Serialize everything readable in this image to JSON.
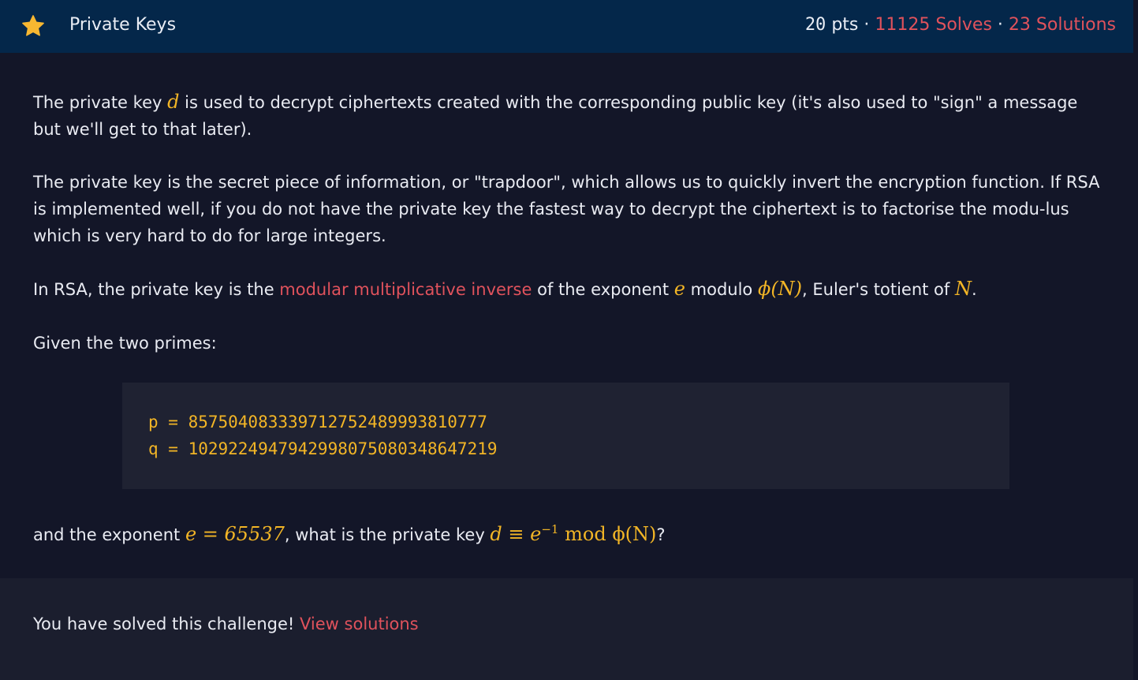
{
  "header": {
    "title": "Private Keys",
    "points": "20",
    "points_suffix": "pts",
    "separator": "·",
    "solves": "11125 Solves",
    "solutions": "23 Solutions"
  },
  "body": {
    "p1_a": "The private key ",
    "p1_d": "d",
    "p1_b": " is used to decrypt ciphertexts created with the corresponding public key (it's also used to \"sign\" a message but we'll get to that later).",
    "p2": "The private key is the secret piece of information, or \"trapdoor\", which allows us to quickly invert the encryption function. If RSA is implemented well, if you do not have the private key the fastest way to decrypt the ciphertext is to factorise the modu-lus which is very hard to do for large integers.",
    "p3_a": "In RSA, the private key is the ",
    "p3_link": "modular multiplicative inverse",
    "p3_b": " of the exponent ",
    "p3_e": "e",
    "p3_c": " modulo ",
    "p3_phi": "ϕ(N)",
    "p3_d": ", Euler's totient of ",
    "p3_N": "N",
    "p3_end": ".",
    "p4": "Given the two primes:",
    "code_p": "p = 857504083339712752489993810777",
    "code_q": "q = 1029224947942998075080348647219",
    "p5_a": "and the exponent ",
    "p5_eq": "e = 65537",
    "p5_b": ", what is the private key ",
    "p5_d": "d ≡ e",
    "p5_sup": "−1",
    "p5_mod": "  mod ϕ(N)",
    "p5_end": "?"
  },
  "footer": {
    "text": "You have solved this challenge! ",
    "link": "View solutions"
  },
  "colors": {
    "header_bg": "#04274a",
    "accent": "#e0525c",
    "math": "#f2b526",
    "star": "#f7b731"
  },
  "icons": [
    "star-icon"
  ]
}
